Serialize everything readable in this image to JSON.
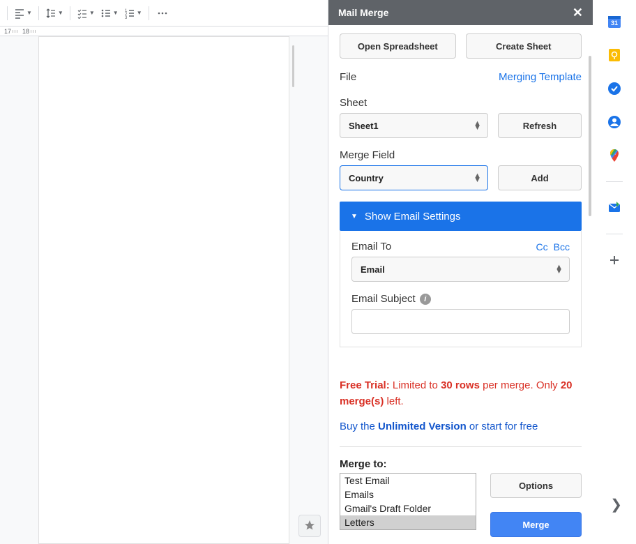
{
  "toolbar": {
    "ruler_marks": [
      "17",
      "18"
    ]
  },
  "panel": {
    "title": "Mail Merge",
    "open_spreadsheet": "Open Spreadsheet",
    "create_sheet": "Create Sheet",
    "file_label": "File",
    "merging_template": "Merging Template",
    "sheet_label": "Sheet",
    "sheet_value": "Sheet1",
    "refresh": "Refresh",
    "merge_field_label": "Merge Field",
    "merge_field_value": "Country",
    "add": "Add",
    "show_email_settings": "Show Email Settings",
    "email_to_label": "Email To",
    "cc": "Cc",
    "bcc": "Bcc",
    "email_to_value": "Email",
    "email_subject_label": "Email Subject",
    "email_subject_value": ""
  },
  "footer": {
    "free_trial": "Free Trial:",
    "limited_to": " Limited to ",
    "rows30": "30 rows",
    "per_merge": " per merge. Only ",
    "merges20": "20 merge(s)",
    "left": " left.",
    "buy_prefix": "Buy the ",
    "unlimited": "Unlimited Version",
    "start_free": " or start for free",
    "merge_to": "Merge to:",
    "options": [
      "Test Email",
      "Emails",
      "Gmail's Draft Folder",
      "Letters"
    ],
    "selected_index": 3,
    "options_btn": "Options",
    "merge_btn": "Merge"
  },
  "rail": {
    "calendar_date": "31"
  }
}
